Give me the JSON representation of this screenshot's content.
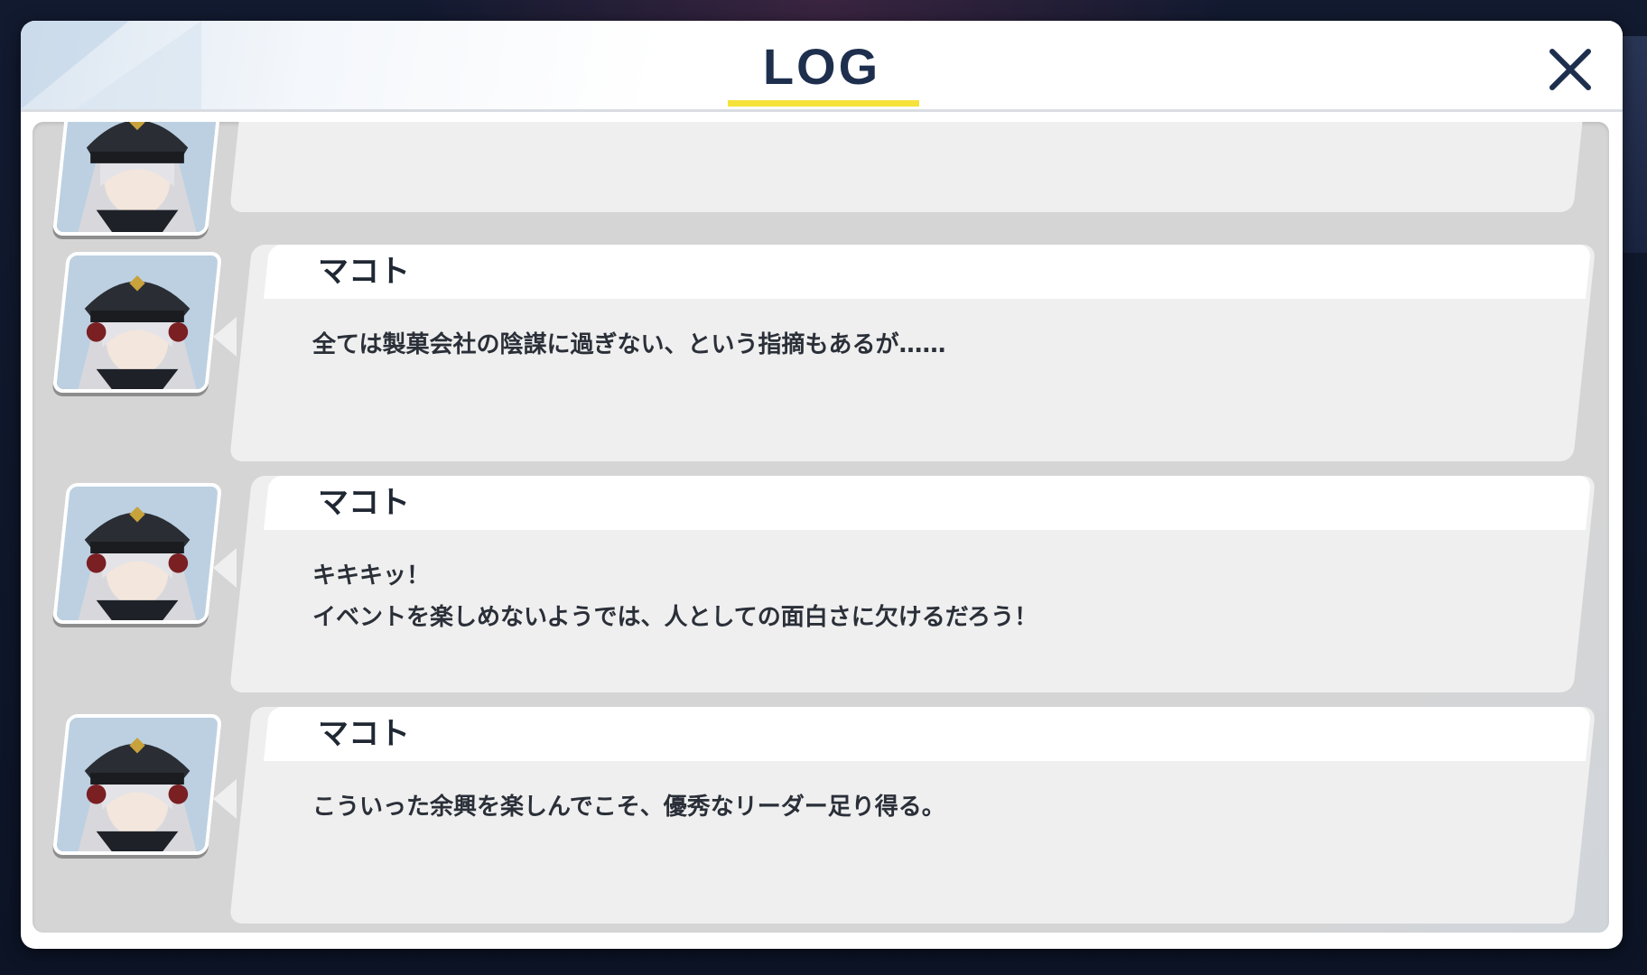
{
  "header": {
    "title": "LOG",
    "close_icon": "close-icon",
    "accent_color": "#f5e23a",
    "title_color": "#1e2f4e"
  },
  "log": {
    "entries": [
      {
        "speaker": "",
        "message": "",
        "avatar_icon": "character-portrait"
      },
      {
        "speaker": "マコト",
        "message": "全ては製菓会社の陰謀に過ぎない、という指摘もあるが……",
        "avatar_icon": "character-portrait"
      },
      {
        "speaker": "マコト",
        "message": "キキキッ！\nイベントを楽しめないようでは、人としての面白さに欠けるだろう！",
        "avatar_icon": "character-portrait"
      },
      {
        "speaker": "マコト",
        "message": "こういった余興を楽しんでこそ、優秀なリーダー足り得る。",
        "avatar_icon": "character-portrait"
      }
    ]
  }
}
